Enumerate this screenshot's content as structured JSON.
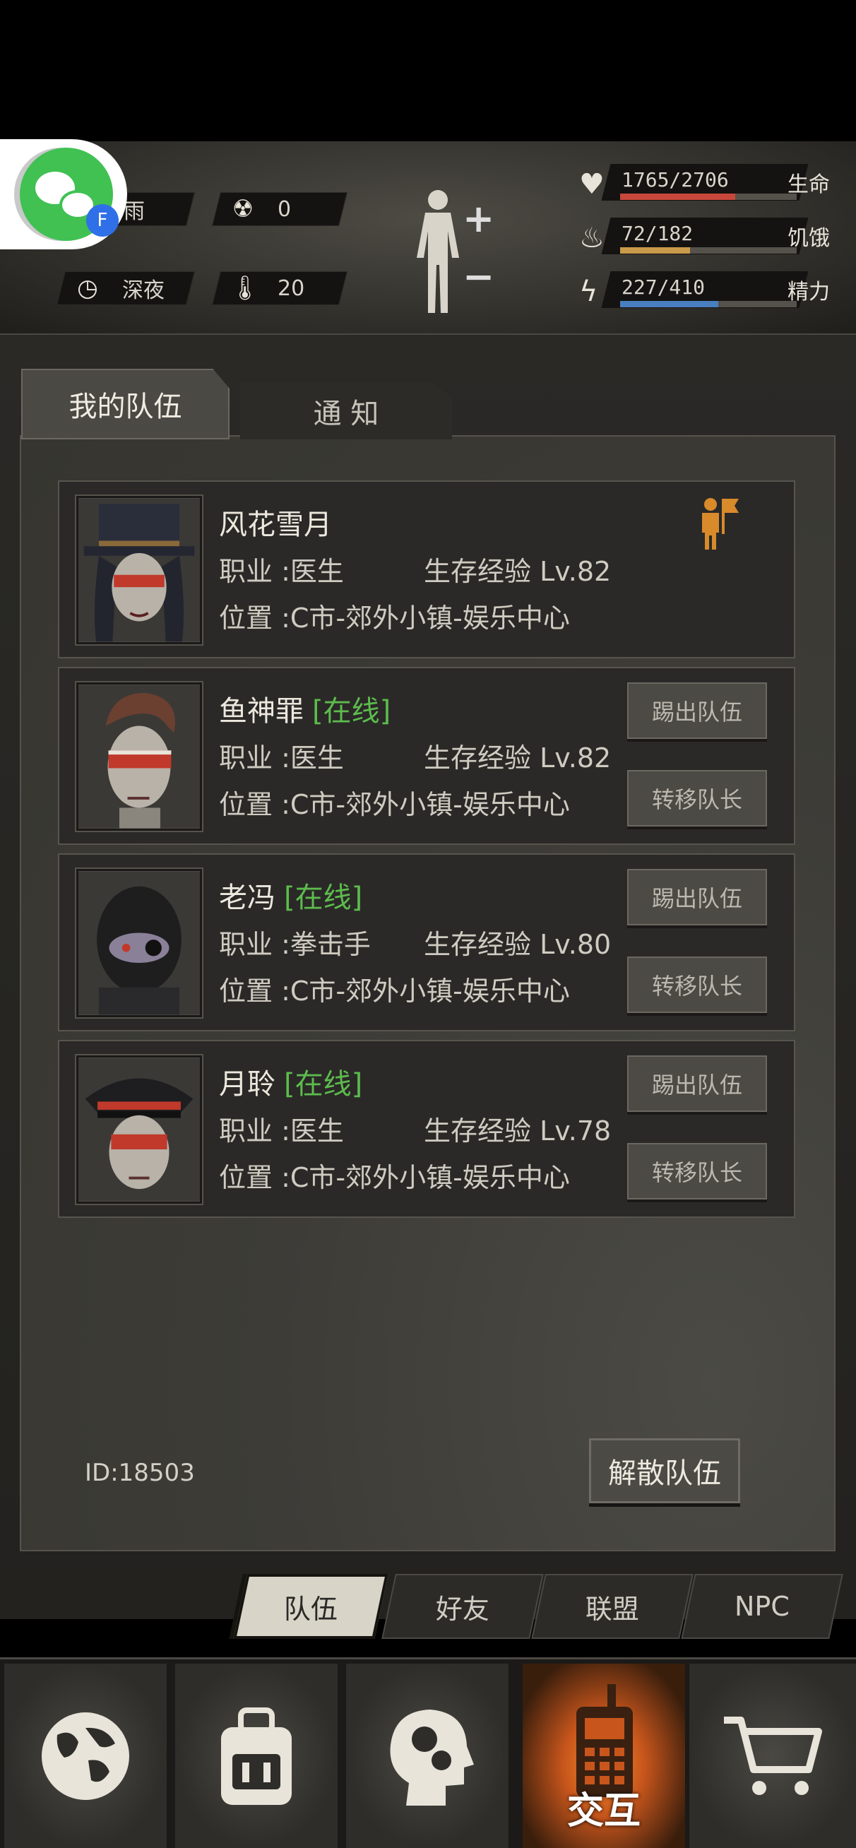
{
  "hud": {
    "weather": "雨",
    "radiation": "0",
    "time_of_day": "深夜",
    "temperature": "20",
    "stats": [
      {
        "label": "生命",
        "value": "1765/2706",
        "fraction": 0.652,
        "color": "#c9473a",
        "icon": "heart-icon"
      },
      {
        "label": "饥饿",
        "value": "72/182",
        "fraction": 0.396,
        "color": "#c99a4a",
        "icon": "stomach-icon"
      },
      {
        "label": "精力",
        "value": "227/410",
        "fraction": 0.554,
        "color": "#4a7fbf",
        "icon": "energy-icon"
      }
    ]
  },
  "tabs": {
    "my_team": "我的队伍",
    "notice": "通 知"
  },
  "members": [
    {
      "name": "风花雪月",
      "online": "",
      "job": "职业 :医生",
      "exp": "生存经验 Lv.82",
      "location": "位置 :C市-郊外小镇-娱乐中心",
      "leader": true
    },
    {
      "name": "鱼神罪",
      "online": "[在线]",
      "job": "职业 :医生",
      "exp": "生存经验 Lv.82",
      "location": "位置 :C市-郊外小镇-娱乐中心",
      "kick": "踢出队伍",
      "transfer": "转移队长"
    },
    {
      "name": "老冯",
      "online": "[在线]",
      "job": "职业 :拳击手",
      "exp": "生存经验 Lv.80",
      "location": "位置 :C市-郊外小镇-娱乐中心",
      "kick": "踢出队伍",
      "transfer": "转移队长"
    },
    {
      "name": "月聆",
      "online": "[在线]",
      "job": "职业 :医生",
      "exp": "生存经验 Lv.78",
      "location": "位置 :C市-郊外小镇-娱乐中心",
      "kick": "踢出队伍",
      "transfer": "转移队长"
    }
  ],
  "team_id": "ID:18503",
  "disband": "解散队伍",
  "subnav": [
    "队伍",
    "好友",
    "联盟",
    "NPC"
  ],
  "bottom_nav": {
    "items": [
      "globe-icon",
      "backpack-icon",
      "skills-head-icon",
      "walkie-talkie-icon",
      "cart-icon"
    ],
    "active_label": "交互"
  },
  "wechat_badge": "F"
}
